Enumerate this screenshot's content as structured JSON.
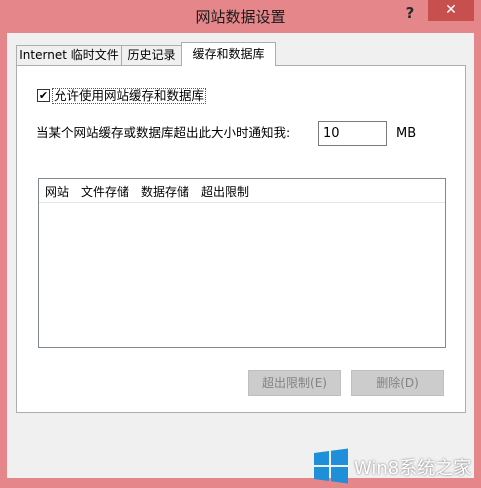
{
  "window": {
    "title": "网站数据设置",
    "help_glyph": "?",
    "close_glyph": "✕",
    "colors": {
      "frame": "#e4868a",
      "close_button": "#c7504f",
      "client": "#f0f0f0",
      "panel": "#ffffff",
      "disabled_button": "#cccccc",
      "brand_blue": "#1e8fd8"
    }
  },
  "tabs": [
    {
      "label": "Internet 临时文件",
      "active": false
    },
    {
      "label": "历史记录",
      "active": false
    },
    {
      "label": "缓存和数据库",
      "active": true
    }
  ],
  "panel": {
    "allow_cache": {
      "label": "允许使用网站缓存和数据库",
      "checked": true,
      "check_glyph": "✔"
    },
    "notify_label": "当某个网站缓存或数据库超出此大小时通知我:",
    "size_value": "10",
    "size_unit": "MB",
    "list_columns": [
      "网站",
      "文件存储",
      "数据存储",
      "超出限制"
    ],
    "buttons": {
      "exceed_limit": "超出限制(E)",
      "delete": "删除(D)"
    }
  },
  "watermark": {
    "text": "Win8系统之家",
    "icon": "windows-logo-icon"
  }
}
